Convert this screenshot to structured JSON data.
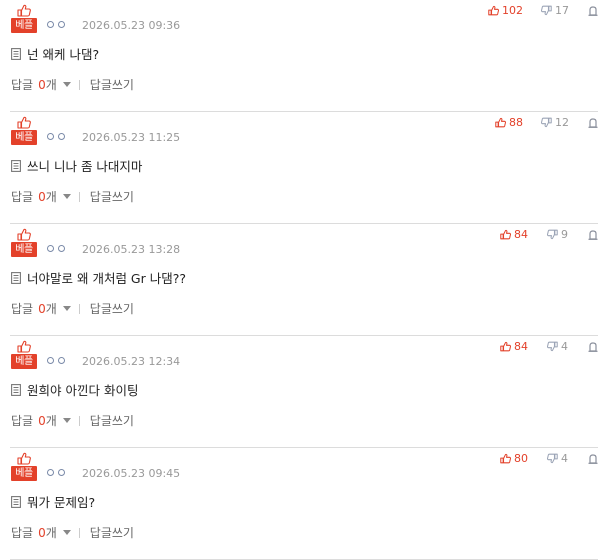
{
  "comments": [
    {
      "badge": "베플",
      "date": "2026.05.23 09:36",
      "up": "102",
      "down": "17",
      "text": "넌 왜케 나댐?",
      "reply_label": "답글",
      "reply_count": "0",
      "reply_unit": "개",
      "write_label": "답글쓰기"
    },
    {
      "badge": "베플",
      "date": "2026.05.23 11:25",
      "up": "88",
      "down": "12",
      "text": "쓰니 니나 좀 나대지마",
      "reply_label": "답글",
      "reply_count": "0",
      "reply_unit": "개",
      "write_label": "답글쓰기"
    },
    {
      "badge": "베플",
      "date": "2026.05.23 13:28",
      "up": "84",
      "down": "9",
      "text": "너야말로 왜 개처럼 Gr 나댐??",
      "reply_label": "답글",
      "reply_count": "0",
      "reply_unit": "개",
      "write_label": "답글쓰기"
    },
    {
      "badge": "베플",
      "date": "2026.05.23 12:34",
      "up": "84",
      "down": "4",
      "text": "원희야 아낀다 화이팅",
      "reply_label": "답글",
      "reply_count": "0",
      "reply_unit": "개",
      "write_label": "답글쓰기"
    },
    {
      "badge": "베플",
      "date": "2026.05.23 09:45",
      "up": "80",
      "down": "4",
      "text": "뭐가 문제임?",
      "reply_label": "답글",
      "reply_count": "0",
      "reply_unit": "개",
      "write_label": "답글쓰기"
    }
  ],
  "colors": {
    "accent": "#e3412a",
    "muted": "#999999",
    "divider": "#dcdcdc"
  },
  "icons": {
    "badge": "thumbs-up-icon",
    "up": "thumbs-up-icon",
    "down": "thumbs-down-icon",
    "report": "report-icon",
    "text": "document-icon",
    "expand": "caret-down-icon"
  }
}
